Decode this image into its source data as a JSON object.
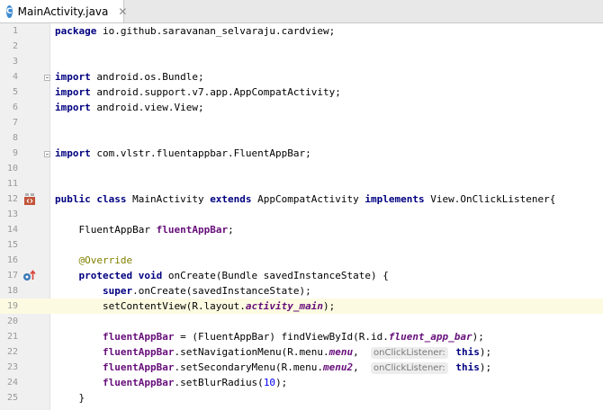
{
  "tab": {
    "icon_letter": "C",
    "title": "MainActivity.java",
    "close": "✕"
  },
  "editor": {
    "current_line": 19,
    "lines": [
      {
        "n": "1",
        "tokens": [
          {
            "t": "package ",
            "c": "kw"
          },
          {
            "t": "io.github.saravanan_selvaraju.cardview;"
          }
        ]
      },
      {
        "n": "2",
        "tokens": []
      },
      {
        "n": "3",
        "tokens": []
      },
      {
        "n": "4",
        "tokens": [
          {
            "t": "import ",
            "c": "kw"
          },
          {
            "t": "android.os.Bundle;"
          }
        ]
      },
      {
        "n": "5",
        "tokens": [
          {
            "t": "import ",
            "c": "kw"
          },
          {
            "t": "android.support.v7.app.AppCompatActivity;"
          }
        ]
      },
      {
        "n": "6",
        "tokens": [
          {
            "t": "import ",
            "c": "kw"
          },
          {
            "t": "android.view.View;"
          }
        ]
      },
      {
        "n": "7",
        "tokens": []
      },
      {
        "n": "8",
        "tokens": []
      },
      {
        "n": "9",
        "tokens": [
          {
            "t": "import ",
            "c": "kw"
          },
          {
            "t": "com.vlstr.fluentappbar.FluentAppBar;"
          }
        ]
      },
      {
        "n": "10",
        "tokens": []
      },
      {
        "n": "11",
        "tokens": []
      },
      {
        "n": "12",
        "tokens": [
          {
            "t": "public class ",
            "c": "kw"
          },
          {
            "t": "MainActivity "
          },
          {
            "t": "extends ",
            "c": "kw"
          },
          {
            "t": "AppCompatActivity "
          },
          {
            "t": "implements ",
            "c": "kw"
          },
          {
            "t": "View.OnClickListener{"
          }
        ]
      },
      {
        "n": "13",
        "tokens": []
      },
      {
        "n": "14",
        "tokens": [
          {
            "t": "    FluentAppBar "
          },
          {
            "t": "fluentAppBar",
            "c": "fld"
          },
          {
            "t": ";"
          }
        ]
      },
      {
        "n": "15",
        "tokens": []
      },
      {
        "n": "16",
        "tokens": [
          {
            "t": "    "
          },
          {
            "t": "@Override",
            "c": "ann"
          }
        ]
      },
      {
        "n": "17",
        "tokens": [
          {
            "t": "    "
          },
          {
            "t": "protected void ",
            "c": "kw"
          },
          {
            "t": "onCreate(Bundle savedInstanceState) {"
          }
        ]
      },
      {
        "n": "18",
        "tokens": [
          {
            "t": "        "
          },
          {
            "t": "super",
            "c": "kw"
          },
          {
            "t": ".onCreate(savedInstanceState);"
          }
        ]
      },
      {
        "n": "19",
        "tokens": [
          {
            "t": "        setContentView(R.layout."
          },
          {
            "t": "activity_main",
            "c": "fld ital"
          },
          {
            "t": ");"
          }
        ]
      },
      {
        "n": "20",
        "tokens": []
      },
      {
        "n": "21",
        "tokens": [
          {
            "t": "        "
          },
          {
            "t": "fluentAppBar",
            "c": "fld"
          },
          {
            "t": " = (FluentAppBar) findViewById(R.id."
          },
          {
            "t": "fluent_app_bar",
            "c": "fld ital"
          },
          {
            "t": ");"
          }
        ]
      },
      {
        "n": "22",
        "tokens": [
          {
            "t": "        "
          },
          {
            "t": "fluentAppBar",
            "c": "fld"
          },
          {
            "t": ".setNavigationMenu(R.menu."
          },
          {
            "t": "menu",
            "c": "fld ital"
          },
          {
            "t": ",  "
          },
          {
            "t": "onClickListener:",
            "c": "hint"
          },
          {
            "t": " "
          },
          {
            "t": "this",
            "c": "kw"
          },
          {
            "t": ");"
          }
        ]
      },
      {
        "n": "23",
        "tokens": [
          {
            "t": "        "
          },
          {
            "t": "fluentAppBar",
            "c": "fld"
          },
          {
            "t": ".setSecondaryMenu(R.menu."
          },
          {
            "t": "menu2",
            "c": "fld ital"
          },
          {
            "t": ",  "
          },
          {
            "t": "onClickListener:",
            "c": "hint"
          },
          {
            "t": " "
          },
          {
            "t": "this",
            "c": "kw"
          },
          {
            "t": ");"
          }
        ]
      },
      {
        "n": "24",
        "tokens": [
          {
            "t": "        "
          },
          {
            "t": "fluentAppBar",
            "c": "fld"
          },
          {
            "t": ".setBlurRadius("
          },
          {
            "t": "10",
            "c": "num"
          },
          {
            "t": ");"
          }
        ]
      },
      {
        "n": "25",
        "tokens": [
          {
            "t": "    }"
          }
        ]
      }
    ]
  },
  "gutter_icons": {
    "line12": "class-hierarchy-icon",
    "line17": "override-method-icon"
  },
  "colors": {
    "keyword": "#000080",
    "field": "#660e7a",
    "annotation": "#808000",
    "number": "#0000ff",
    "current_line": "#fcfae1"
  }
}
